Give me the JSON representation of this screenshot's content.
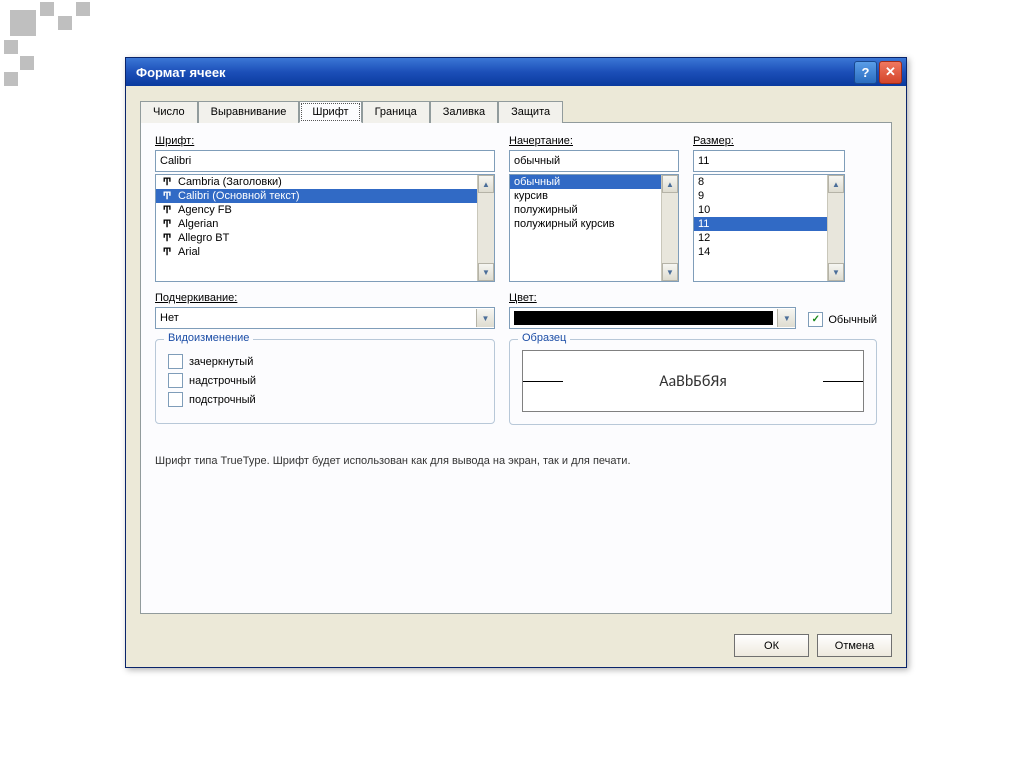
{
  "dialog": {
    "title": "Формат ячеек"
  },
  "tabs": {
    "items": [
      {
        "label": "Число"
      },
      {
        "label": "Выравнивание"
      },
      {
        "label": "Шрифт"
      },
      {
        "label": "Граница"
      },
      {
        "label": "Заливка"
      },
      {
        "label": "Защита"
      }
    ],
    "active_index": 2
  },
  "font_section": {
    "label": "Шрифт:",
    "value": "Calibri",
    "items": [
      {
        "name": "Cambria (Заголовки)",
        "tt": true,
        "selected": false
      },
      {
        "name": "Calibri (Основной текст)",
        "tt": true,
        "selected": true
      },
      {
        "name": "Agency FB",
        "tt": true,
        "selected": false
      },
      {
        "name": "Algerian",
        "tt": true,
        "selected": false
      },
      {
        "name": "Allegro BT",
        "tt": true,
        "selected": false
      },
      {
        "name": "Arial",
        "tt": true,
        "selected": false
      }
    ]
  },
  "style_section": {
    "label": "Начертание:",
    "value": "обычный",
    "items": [
      {
        "name": "обычный",
        "selected": true
      },
      {
        "name": "курсив",
        "selected": false
      },
      {
        "name": "полужирный",
        "selected": false
      },
      {
        "name": "полужирный курсив",
        "selected": false
      }
    ]
  },
  "size_section": {
    "label": "Размер:",
    "value": "11",
    "items": [
      {
        "name": "8",
        "selected": false
      },
      {
        "name": "9",
        "selected": false
      },
      {
        "name": "10",
        "selected": false
      },
      {
        "name": "11",
        "selected": true
      },
      {
        "name": "12",
        "selected": false
      },
      {
        "name": "14",
        "selected": false
      }
    ]
  },
  "underline": {
    "label": "Подчеркивание:",
    "value": "Нет"
  },
  "color": {
    "label": "Цвет:",
    "swatch": "#000000",
    "normal_checkbox_label": "Обычный",
    "normal_checked": true
  },
  "effects": {
    "title": "Видоизменение",
    "items": [
      {
        "label": "зачеркнутый",
        "checked": false
      },
      {
        "label": "надстрочный",
        "checked": false
      },
      {
        "label": "подстрочный",
        "checked": false
      }
    ]
  },
  "sample": {
    "title": "Образец",
    "text": "AaBbБбЯя"
  },
  "note": "Шрифт типа TrueType. Шрифт будет использован как для вывода на экран, так и для печати.",
  "buttons": {
    "ok": "ОК",
    "cancel": "Отмена"
  }
}
